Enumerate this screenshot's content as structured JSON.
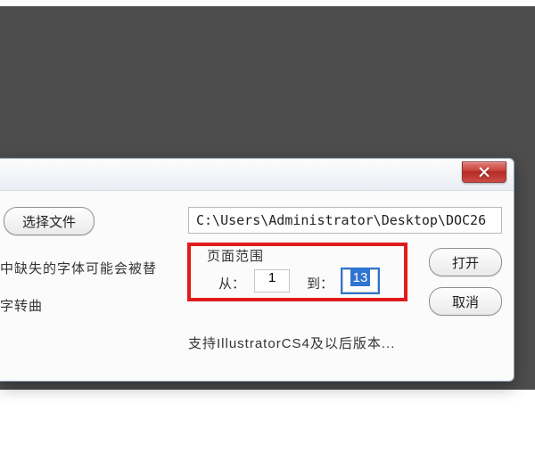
{
  "titlebar": {
    "close_icon_name": "close-icon"
  },
  "buttons": {
    "select_file": "选择文件",
    "open": "打开",
    "cancel": "取消"
  },
  "path": {
    "value": "C:\\Users\\Administrator\\Desktop\\DOC26"
  },
  "warnings": {
    "line1": "中缺失的字体可能会被替",
    "line2": "字转曲"
  },
  "range": {
    "group_label": "页面范围",
    "from_label": "从：",
    "to_label": "到：",
    "from_value": "1",
    "to_value": "13"
  },
  "footer": {
    "note": "支持IllustratorCS4及以后版本..."
  }
}
